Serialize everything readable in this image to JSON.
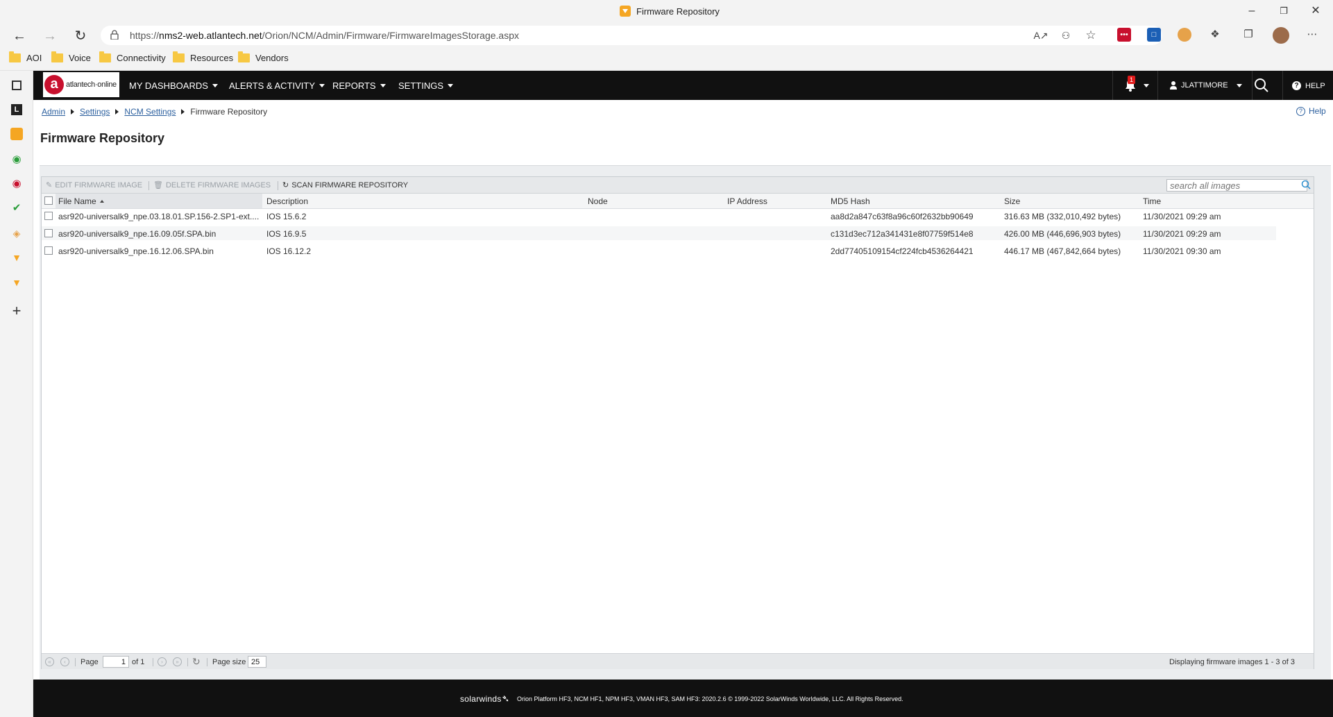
{
  "browser": {
    "tab_title": "Firmware Repository",
    "url_prefix": "https://",
    "url_host": "nms2-web.atlantech.net",
    "url_path": "/Orion/NCM/Admin/Firmware/FirmwareImagesStorage.aspx",
    "bookmarks": [
      "AOI",
      "Voice",
      "Connectivity",
      "Resources",
      "Vendors"
    ]
  },
  "app": {
    "logo_text": "atlantech·online",
    "menu": [
      "MY DASHBOARDS",
      "ALERTS & ACTIVITY",
      "REPORTS",
      "SETTINGS"
    ],
    "notification_count": "1",
    "user": "JLATTIMORE",
    "help": "HELP"
  },
  "breadcrumb": {
    "items": [
      "Admin",
      "Settings",
      "NCM Settings"
    ],
    "current": "Firmware Repository"
  },
  "help_link": "Help",
  "page_title": "Firmware Repository",
  "toolbar": {
    "edit": "EDIT FIRMWARE IMAGE",
    "delete": "DELETE FIRMWARE IMAGES",
    "scan": "SCAN FIRMWARE REPOSITORY",
    "search_placeholder": "search all images"
  },
  "table": {
    "columns": [
      "File Name",
      "Description",
      "Node",
      "IP Address",
      "MD5 Hash",
      "Size",
      "Time"
    ],
    "rows": [
      {
        "file": "asr920-universalk9_npe.03.18.01.SP.156-2.SP1-ext....",
        "desc": "IOS 15.6.2",
        "node": "",
        "ip": "",
        "md5": "aa8d2a847c63f8a96c60f2632bb90649",
        "size": "316.63 MB (332,010,492 bytes)",
        "time": "11/30/2021 09:29 am"
      },
      {
        "file": "asr920-universalk9_npe.16.09.05f.SPA.bin",
        "desc": "IOS 16.9.5",
        "node": "",
        "ip": "",
        "md5": "c131d3ec712a341431e8f07759f514e8",
        "size": "426.00 MB (446,696,903 bytes)",
        "time": "11/30/2021 09:29 am"
      },
      {
        "file": "asr920-universalk9_npe.16.12.06.SPA.bin",
        "desc": "IOS 16.12.2",
        "node": "",
        "ip": "",
        "md5": "2dd77405109154cf224fcb4536264421",
        "size": "446.17 MB (467,842,664 bytes)",
        "time": "11/30/2021 09:30 am"
      }
    ]
  },
  "pager": {
    "page_label": "Page",
    "page_value": "1",
    "of_label": "of 1",
    "size_label": "Page size",
    "size_value": "25",
    "display_text": "Displaying firmware images 1 - 3 of 3"
  },
  "footer": {
    "brand": "solarwinds",
    "text": "Orion Platform HF3, NCM HF1, NPM HF3, VMAN HF3, SAM HF3: 2020.2.6 © 1999-2022 SolarWinds Worldwide, LLC. All Rights Reserved."
  },
  "colors": {
    "topbar": "#111111",
    "brand_red": "#c8102e",
    "link": "#2b5f9e"
  }
}
